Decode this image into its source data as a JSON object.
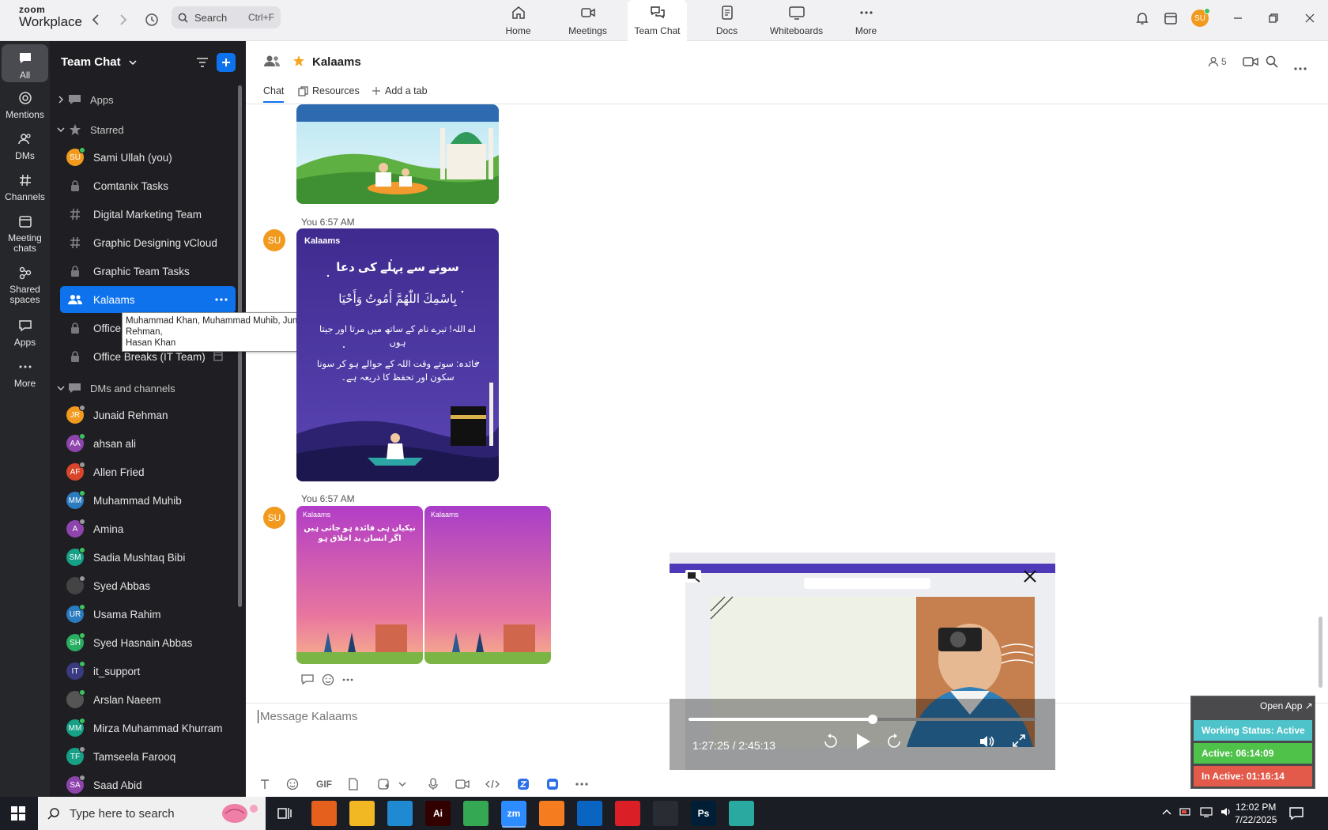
{
  "app": {
    "brand_top": "zoom",
    "brand_bottom": "Workplace"
  },
  "search": {
    "placeholder": "Search",
    "shortcut": "Ctrl+F"
  },
  "tabs": [
    {
      "label": "Home",
      "icon": "home-icon"
    },
    {
      "label": "Meetings",
      "icon": "video-camera-icon"
    },
    {
      "label": "Team Chat",
      "icon": "chat-bubbles-icon"
    },
    {
      "label": "Docs",
      "icon": "document-icon"
    },
    {
      "label": "Whiteboards",
      "icon": "whiteboard-icon"
    },
    {
      "label": "More",
      "icon": "more-dots-icon"
    }
  ],
  "user": {
    "initials": "SU",
    "color": "#f29a1e"
  },
  "rail": [
    {
      "label": "All",
      "icon": "chat-icon"
    },
    {
      "label": "Mentions",
      "icon": "at-icon"
    },
    {
      "label": "DMs",
      "icon": "people-icon"
    },
    {
      "label": "Channels",
      "icon": "hash-icon"
    },
    {
      "label": "Meeting chats",
      "icon": "calendar-icon"
    },
    {
      "label": "Shared spaces",
      "icon": "shared-icon"
    },
    {
      "label": "Apps",
      "icon": "apps-icon"
    },
    {
      "label": "More",
      "icon": "more-dots-icon"
    }
  ],
  "sidebar": {
    "title": "Team Chat",
    "apps_label": "Apps",
    "starred_label": "Starred",
    "dms_label": "DMs and channels",
    "starred": [
      {
        "label": "Sami Ullah (you)",
        "kind": "avatar",
        "initials": "SU",
        "color": "#f29a1e",
        "status": "active"
      },
      {
        "label": "Comtanix Tasks",
        "kind": "lock"
      },
      {
        "label": "Digital Marketing Team",
        "kind": "hash"
      },
      {
        "label": "Graphic Designing vCloud",
        "kind": "hash"
      },
      {
        "label": "Graphic Team Tasks",
        "kind": "lock"
      },
      {
        "label": "Kalaams",
        "kind": "group"
      },
      {
        "label": "Office",
        "kind": "lock"
      },
      {
        "label": "Office Breaks (IT Team)",
        "kind": "lock"
      }
    ],
    "dms": [
      {
        "label": "Junaid Rehman",
        "initials": "JR",
        "color": "#f29a1e",
        "status": "idle"
      },
      {
        "label": "ahsan ali",
        "initials": "AA",
        "color": "#8e44ad",
        "status": "active"
      },
      {
        "label": "Allen Fried",
        "initials": "AF",
        "color": "#d9452b",
        "status": "idle"
      },
      {
        "label": "Muhammad Muhib",
        "initials": "MM",
        "color": "#2b7bbf",
        "status": "active"
      },
      {
        "label": "Amina",
        "initials": "A",
        "color": "#8e44ad",
        "status": "idle"
      },
      {
        "label": "Sadia Mushtaq Bibi",
        "initials": "SM",
        "color": "#16a085",
        "status": "active"
      },
      {
        "label": "Syed Abbas",
        "initials": "",
        "color": "#444444",
        "status": "idle"
      },
      {
        "label": "Usama Rahim",
        "initials": "UR",
        "color": "#2b7bbf",
        "status": "active"
      },
      {
        "label": "Syed Hasnain Abbas",
        "initials": "SH",
        "color": "#27ae60",
        "status": "active"
      },
      {
        "label": "it_support",
        "initials": "IT",
        "color": "#3a3a80",
        "status": "active"
      },
      {
        "label": "Arslan Naeem",
        "initials": "",
        "color": "#555555",
        "status": "active"
      },
      {
        "label": "Mirza Muhammad Khurram",
        "initials": "MM",
        "color": "#16a085",
        "status": "active"
      },
      {
        "label": "Tamseela Farooq",
        "initials": "TF",
        "color": "#16a085",
        "status": "idle"
      },
      {
        "label": "Saad Abid",
        "initials": "SA",
        "color": "#8e44ad",
        "status": "idle"
      }
    ]
  },
  "tooltip": {
    "line1": "Muhammad Khan, Muhammad Muhib, Junaid Rehman,",
    "line2": "Hasan Khan"
  },
  "channel": {
    "name": "Kalaams",
    "member_count": "5",
    "tabs": {
      "chat": "Chat",
      "resources": "Resources",
      "add": "Add a tab"
    }
  },
  "messages": [
    {
      "sender": "You",
      "time": "6:57 AM",
      "initials": "SU"
    },
    {
      "sender": "You",
      "time": "6:57 AM",
      "initials": "SU"
    }
  ],
  "posters": {
    "logo": "Kalaams",
    "urdu_title": "سونے سے پہلے کی دعا",
    "arabic": "بِاسْمِكَ اللّٰهُمَّ أَمُوتُ وَأَحْيَا",
    "urdu_line": "اے اللہ! تیرے نام کے ساتھ میں مرتا اور جیتا ہوں",
    "benefit": "فائدہ: سوتے وقت اللہ کے حوالے ہو کر سونا سکون اور تحفظ کا ذریعہ ہے۔",
    "pink_title": "نیکیاں ہی فائدہ ہو جاتی ہیں اگر انسان بد اخلاق ہو"
  },
  "composer": {
    "placeholder": "Message Kalaams",
    "gif_label": "GIF"
  },
  "video": {
    "time": "1:27:25 / 2:45:13",
    "progress": 0.53
  },
  "status_widget": {
    "open_app": "Open App ↗",
    "working": "Working Status: Active",
    "active": "Active: 06:14:09",
    "inactive": "In Active: 01:16:14",
    "colors": {
      "working": "#4ec3c9",
      "active": "#4fc24a",
      "inactive": "#e35a4a"
    }
  },
  "taskbar": {
    "search_placeholder": "Type here to search",
    "time": "12:02 PM",
    "date": "7/22/2025",
    "apps": [
      {
        "name": "firefox-app-icon",
        "color": "#e6601d",
        "text": ""
      },
      {
        "name": "file-explorer-app-icon",
        "color": "#f2b824",
        "text": ""
      },
      {
        "name": "vscode-app-icon",
        "color": "#1f8ad2",
        "text": ""
      },
      {
        "name": "illustrator-app-icon",
        "color": "#330000",
        "text": "Ai"
      },
      {
        "name": "chrome-app-icon",
        "color": "#34a853",
        "text": ""
      },
      {
        "name": "zoom-app-icon",
        "color": "#2d8cff",
        "text": "zm"
      },
      {
        "name": "xampp-app-icon",
        "color": "#f57c1f",
        "text": ""
      },
      {
        "name": "outlook-app-icon",
        "color": "#0a64c1",
        "text": ""
      },
      {
        "name": "creative-cloud-app-icon",
        "color": "#da1f26",
        "text": ""
      },
      {
        "name": "pen-tool-app-icon",
        "color": "#2a2c33",
        "text": ""
      },
      {
        "name": "photoshop-app-icon",
        "color": "#001e36",
        "text": "Ps"
      },
      {
        "name": "app-icon",
        "color": "#2aa9a0",
        "text": ""
      }
    ]
  }
}
